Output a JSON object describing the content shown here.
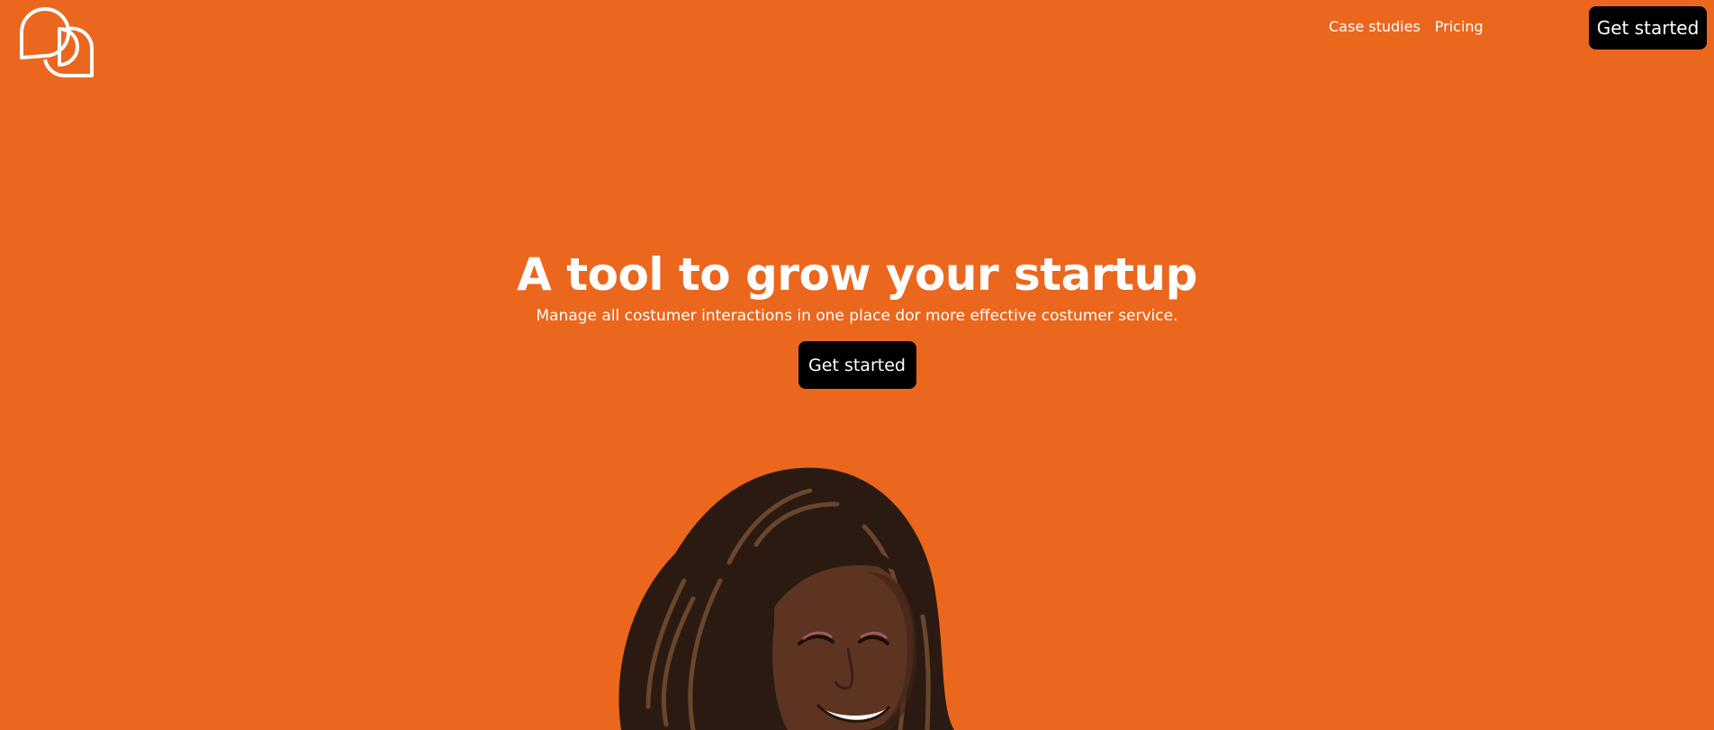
{
  "header": {
    "nav_items": [
      "Case studies",
      "Pricing"
    ],
    "cta_label": "Get started"
  },
  "hero": {
    "title": "A tool to grow your startup",
    "subtitle": "Manage all costumer interactions in one place dor more effective costumer service.",
    "cta_label": "Get started"
  },
  "icons": {
    "logo": "chat-bubbles-logo-icon"
  },
  "colors": {
    "background": "#EB671D",
    "button_bg": "#000000",
    "text": "#FFFFFF"
  }
}
